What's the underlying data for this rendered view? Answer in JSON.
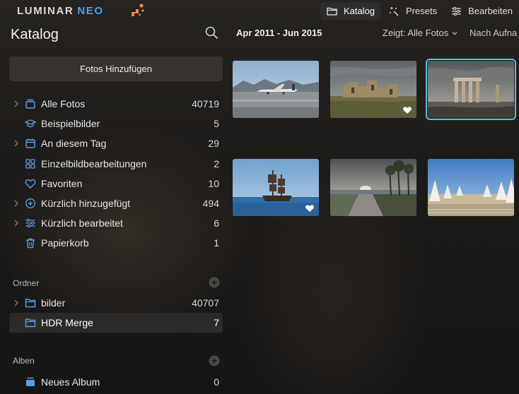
{
  "app": {
    "logo_text": "LUMINAR",
    "logo_suffix": "NEO"
  },
  "nav": {
    "items": [
      {
        "label": "Katalog",
        "icon": "folder-icon",
        "active": true
      },
      {
        "label": "Presets",
        "icon": "magic-wand-icon",
        "active": false
      },
      {
        "label": "Bearbeiten",
        "icon": "sliders-icon",
        "active": false
      }
    ]
  },
  "sidebar": {
    "title": "Katalog",
    "add_button": "Fotos Hinzufügen",
    "catalog": [
      {
        "label": "Alle Fotos",
        "count": "40719",
        "icon": "stack-icon",
        "chevron": true
      },
      {
        "label": "Beispielbilder",
        "count": "5",
        "icon": "graduation-cap-icon",
        "chevron": false
      },
      {
        "label": "An diesem Tag",
        "count": "29",
        "icon": "calendar-icon",
        "chevron": true
      },
      {
        "label": "Einzelbildbearbeitungen",
        "count": "2",
        "icon": "grid-icon",
        "chevron": false
      },
      {
        "label": "Favoriten",
        "count": "10",
        "icon": "heart-icon",
        "chevron": false
      },
      {
        "label": "Kürzlich hinzugefügt",
        "count": "494",
        "icon": "plus-circle-icon",
        "chevron": true
      },
      {
        "label": "Kürzlich bearbeitet",
        "count": "6",
        "icon": "sliders-icon",
        "chevron": true
      },
      {
        "label": "Papierkorb",
        "count": "1",
        "icon": "trash-icon",
        "chevron": false
      }
    ],
    "folders_header": "Ordner",
    "folders": [
      {
        "label": "bilder",
        "count": "40707",
        "icon": "folder-icon",
        "chevron": true,
        "selected": false
      },
      {
        "label": "HDR Merge",
        "count": "7",
        "icon": "folder-icon",
        "chevron": false,
        "selected": true
      }
    ],
    "albums_header": "Alben",
    "albums": [
      {
        "label": "Neues Album",
        "count": "0",
        "icon": "album-icon",
        "chevron": false
      }
    ]
  },
  "main": {
    "date_range": "Apr 2011 - Jun 2015",
    "filter_label": "Zeigt: Alle Fotos",
    "sort_label": "Nach Aufna",
    "photos": [
      {
        "subject": "airplane-on-runway",
        "favorite": false,
        "selected": false
      },
      {
        "subject": "ancient-ruins",
        "favorite": true,
        "selected": false
      },
      {
        "subject": "temple-columns",
        "favorite": false,
        "selected": true
      },
      {
        "subject": "pirate-ship",
        "favorite": true,
        "selected": false
      },
      {
        "subject": "seaside-promenade",
        "favorite": false,
        "selected": false
      },
      {
        "subject": "beach-umbrellas",
        "favorite": false,
        "selected": false
      }
    ]
  },
  "colors": {
    "accent_blue": "#4aa3e8",
    "selection_outline": "#58c0d9",
    "icon_blue": "#5b9be6",
    "logo_orange": "#f08a3c"
  }
}
